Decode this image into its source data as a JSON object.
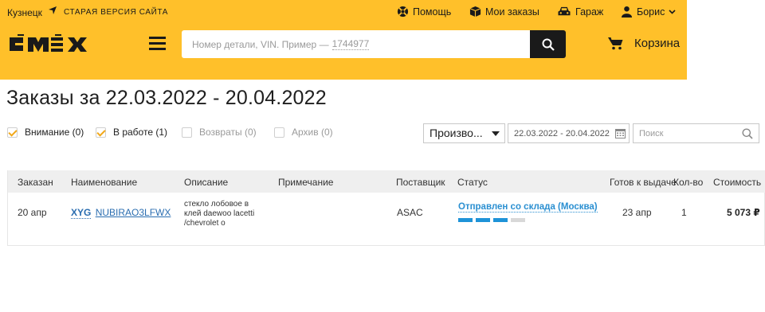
{
  "header": {
    "city": "Кузнецк",
    "old_version": "СТАРАЯ ВЕРСИЯ САЙТА",
    "help": "Помощь",
    "my_orders": "Мои заказы",
    "garage": "Гараж",
    "user": "Борис",
    "search_placeholder": "Номер детали, VIN. Пример —",
    "search_example": "1744977",
    "cart": "Корзина",
    "brand_color": "#ffc02a"
  },
  "page": {
    "title": "Заказы за 22.03.2022 - 20.04.2022"
  },
  "filters": [
    {
      "label": "Внимание (0)",
      "checked": true
    },
    {
      "label": "В работе (1)",
      "checked": true
    },
    {
      "label": "Возвраты (0)",
      "checked": false
    },
    {
      "label": "Архив (0)",
      "checked": false
    }
  ],
  "sort_select": {
    "value": "Произво..."
  },
  "date_range": {
    "value": "22.03.2022 - 20.04.2022"
  },
  "list_search": {
    "placeholder": "Поиск"
  },
  "table": {
    "columns": [
      "Заказан",
      "Наименование",
      "Описание",
      "Примечание",
      "Поставщик",
      "Статус",
      "Готов к выдаче",
      "Кол-во",
      "Стоимость"
    ],
    "rows": [
      {
        "ordered": "20 апр",
        "brand": "XYG",
        "article": "NUBIRAO3LFWX",
        "desc_lines": [
          "стекло лобовое в",
          "клей daewoo lacetti",
          "/chevrolet о"
        ],
        "note": "",
        "supplier": "ASAC",
        "status": "Отправлен со склада (Москва)",
        "status_steps_done": 3,
        "status_steps_total": 4,
        "ready": "23 апр",
        "qty": "1",
        "price": "5 073 ₽"
      }
    ]
  }
}
